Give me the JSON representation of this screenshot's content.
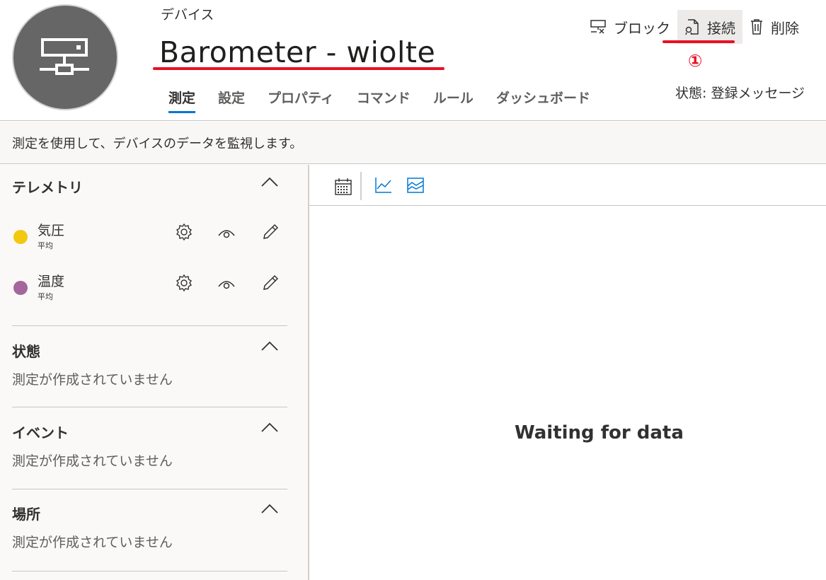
{
  "header": {
    "subtitle": "デバイス",
    "title": "Barometer - wiolte",
    "status": "状態: 登録メッセージ",
    "annotation": "①",
    "tabs": [
      "測定",
      "設定",
      "プロパティ",
      "コマンド",
      "ルール",
      "ダッシュボード"
    ],
    "actions": {
      "block": "ブロック",
      "connect": "接続",
      "delete": "削除"
    }
  },
  "banner": {
    "text": "測定を使用して、デバイスのデータを監視します。"
  },
  "sidebar": {
    "telemetry": {
      "title": "テレメトリ",
      "items": [
        {
          "name": "気圧",
          "sub": "平均",
          "color": "#f2c811"
        },
        {
          "name": "温度",
          "sub": "平均",
          "color": "#a4669c"
        }
      ]
    },
    "state": {
      "title": "状態",
      "empty": "測定が作成されていません"
    },
    "event": {
      "title": "イベント",
      "empty": "測定が作成されていません"
    },
    "location": {
      "title": "場所",
      "empty": "測定が作成されていません"
    }
  },
  "main": {
    "waiting": "Waiting for data"
  },
  "colors": {
    "accent": "#0078d4",
    "annotation": "#e81123",
    "avatar": "#666666"
  }
}
